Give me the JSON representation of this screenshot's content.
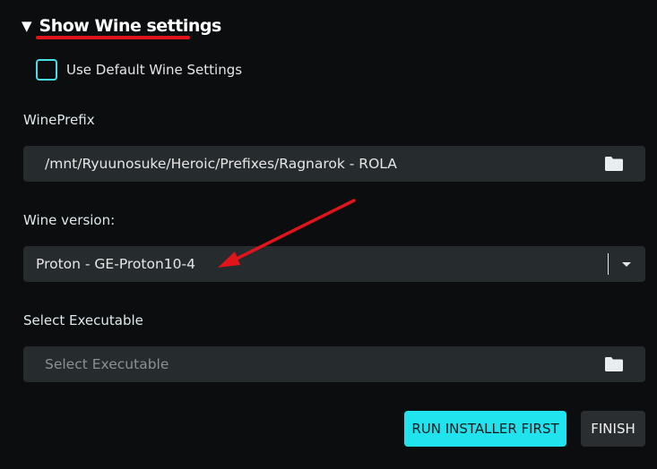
{
  "section": {
    "toggle_glyph": "▼",
    "title": "Show Wine settings"
  },
  "default_settings": {
    "label": "Use Default Wine Settings",
    "checked": false
  },
  "wine_prefix": {
    "label": "WinePrefix",
    "value": "/mnt/Ryuunosuke/Heroic/Prefixes/Ragnarok - ROLA",
    "icon": "folder-icon"
  },
  "wine_version": {
    "label": "Wine version:",
    "selected": "Proton - GE-Proton10-4",
    "icon": "chevron-down-icon"
  },
  "executable": {
    "label": "Select Executable",
    "placeholder": "Select Executable",
    "value": "",
    "icon": "folder-icon"
  },
  "actions": {
    "run_installer_label": "RUN INSTALLER FIRST",
    "finish_label": "FINISH"
  },
  "colors": {
    "background": "#0b0d0f",
    "accent": "#21e3ee",
    "field_bg": "#262b2e",
    "annotation_red": "#e0141a"
  }
}
